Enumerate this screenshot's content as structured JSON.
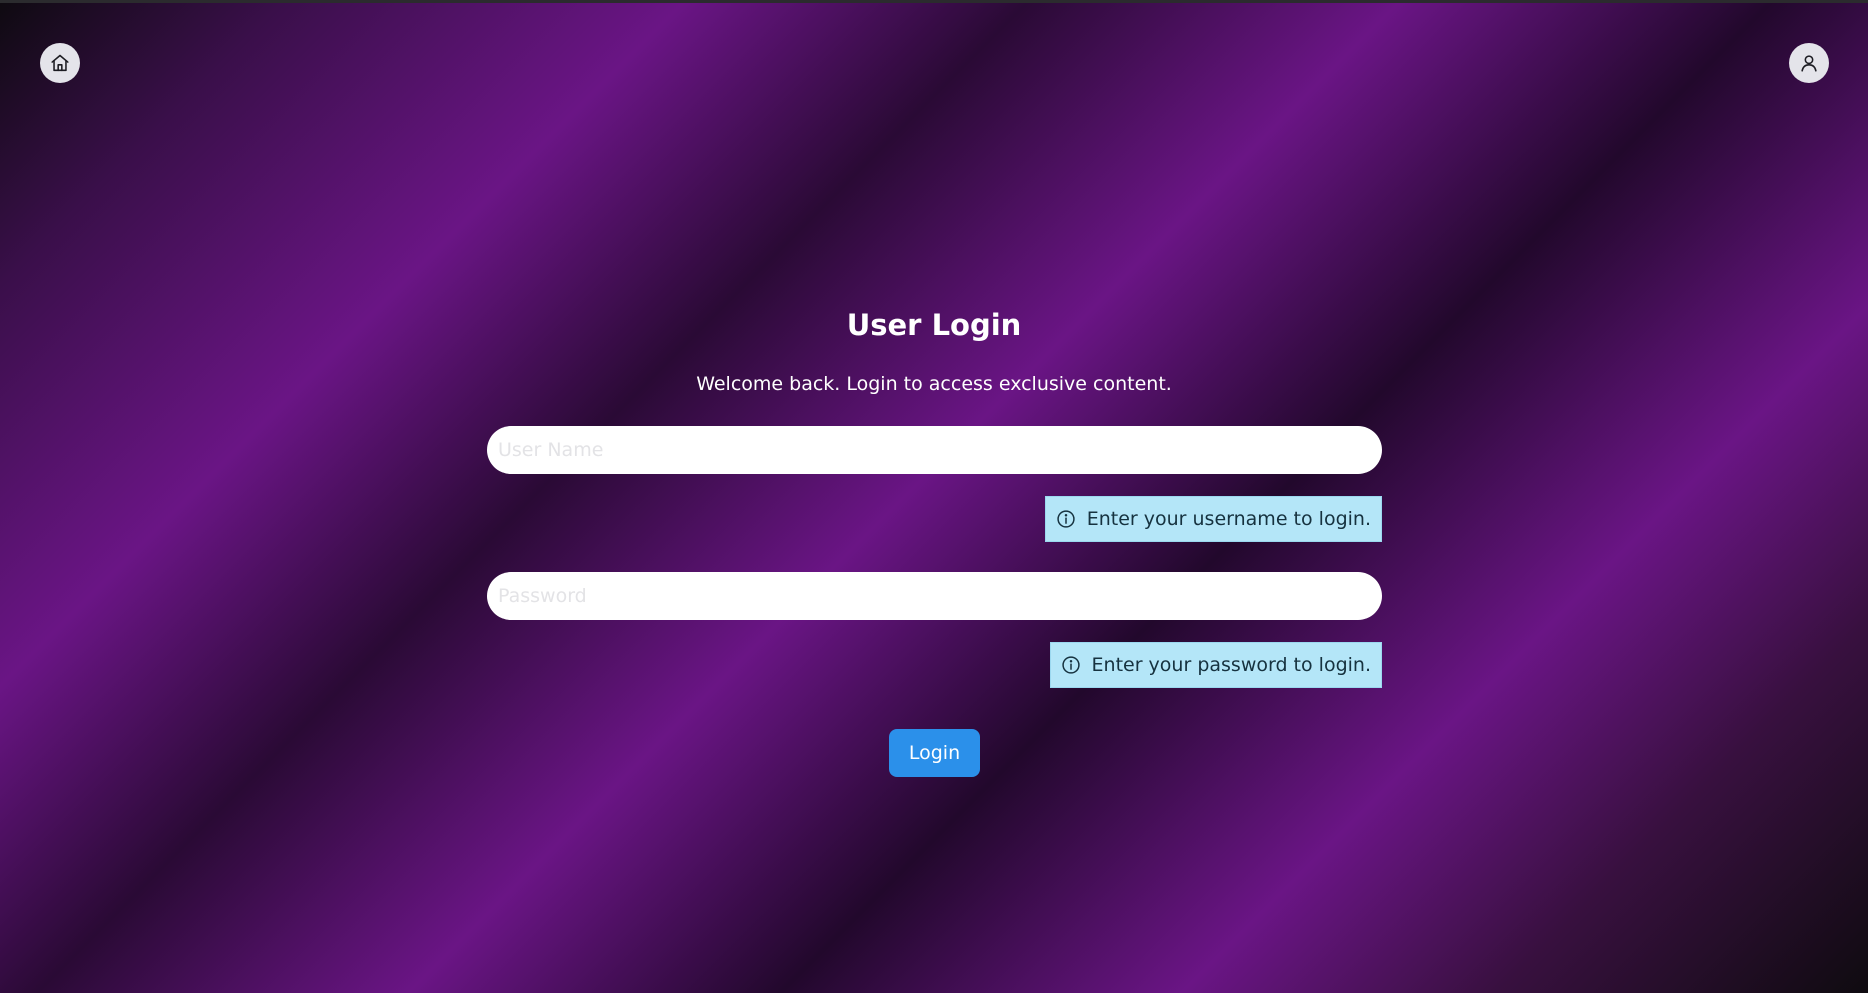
{
  "header": {
    "home_icon": "home-icon",
    "user_icon": "user-icon"
  },
  "login": {
    "title": "User Login",
    "subtitle": "Welcome back. Login to access exclusive content.",
    "username": {
      "placeholder": "User Name",
      "value": "",
      "hint": "Enter your username to login.",
      "hint_icon": "info-icon"
    },
    "password": {
      "placeholder": "Password",
      "value": "",
      "hint": "Enter your password to login.",
      "hint_icon": "info-icon"
    },
    "submit_label": "Login"
  },
  "colors": {
    "background_dark": "#0e0a10",
    "background_purple": "#6a1585",
    "hint_background": "#b4e6f8",
    "hint_text": "#16323f",
    "button_primary": "#2b90ea",
    "icon_button_bg": "#e4e4ea"
  }
}
